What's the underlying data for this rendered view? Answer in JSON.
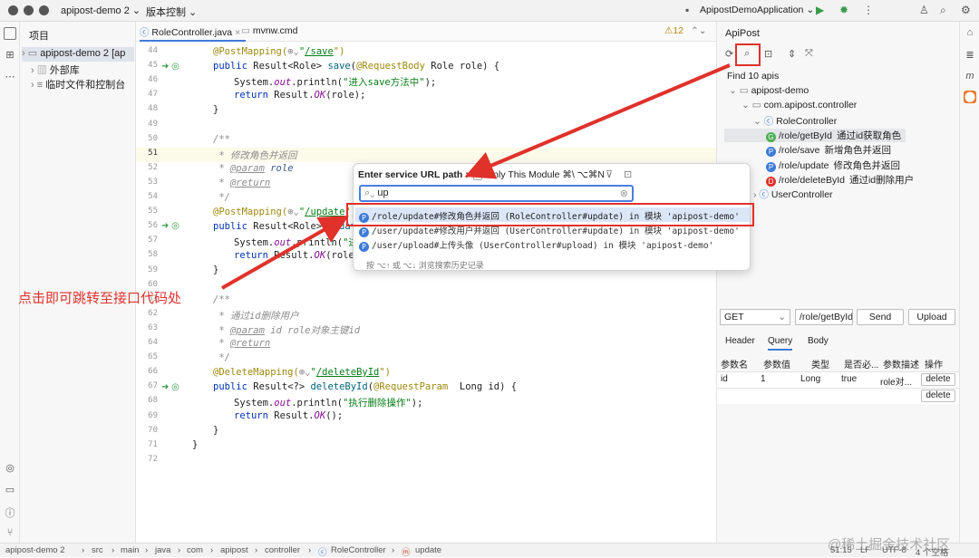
{
  "titlebar": {
    "project": "apipost-demo 2",
    "vcs": "版本控制",
    "run_config": "ApipostDemoApplication"
  },
  "project_panel": {
    "title": "项目",
    "root": "apipost-demo 2 [ap",
    "ext_libs": "外部库",
    "scratches": "临时文件和控制台"
  },
  "tabs": [
    {
      "label": "RoleController.java"
    },
    {
      "label": "mvnw.cmd"
    }
  ],
  "inspection": "⚠12",
  "line_numbers": [
    "44",
    "45",
    "46",
    "47",
    "48",
    "49",
    "50",
    "51",
    "52",
    "53",
    "54",
    "55",
    "56",
    "57",
    "58",
    "59",
    "60",
    "61",
    "62",
    "63",
    "64",
    "65",
    "66",
    "67",
    "68",
    "69",
    "70",
    "71",
    "72"
  ],
  "code": {
    "l44_ann": "@PostMapping(",
    "l44_icons": "⊕⌄",
    "l44_q": "\"",
    "l44_path": "/save",
    "l44_end": "\")",
    "l45_kw": "public ",
    "l45_a": "Result<Role> ",
    "l45_fn": "save",
    "l45_b": "(",
    "l45_ann": "@RequestBody ",
    "l45_c": "Role role) {",
    "l46_a": "System.",
    "l46_fld": "out",
    "l46_b": ".println(",
    "l46_str": "\"进入save方法中\"",
    "l46_c": ");",
    "l47_kw": "return ",
    "l47_a": "Result.",
    "l47_fn": "OK",
    "l47_b": "(role);",
    "l48": "}",
    "l50": "/**",
    "l51": " * 修改角色并返回",
    "l52_a": " * ",
    "l52_tag": "@param",
    "l52_b": " role",
    "l53_a": " * ",
    "l53_tag": "@return",
    "l54": " */",
    "l55_ann": "@PostMapping(",
    "l55_icons": "⊕⌄",
    "l55_q": "\"",
    "l55_path": "/update",
    "l55_end": "\")",
    "l56_kw": "public ",
    "l56_a": "Result<Role> ",
    "l56_fn": "update",
    "l57_a": "System.",
    "l57_fld": "out",
    "l57_b": ".println(",
    "l57_str": "\"进入",
    "l58_kw": "return ",
    "l58_a": "Result.",
    "l58_fn": "OK",
    "l58_b": "(role)",
    "l59": "}",
    "l61": "/**",
    "l62": " * 通过id删除用户",
    "l63_a": " * ",
    "l63_tag": "@param",
    "l63_b": " id role对象主键id",
    "l64_a": " * ",
    "l64_tag": "@return",
    "l65": " */",
    "l66_ann": "@DeleteMapping(",
    "l66_icons": "⊕⌄",
    "l66_q": "\"",
    "l66_path": "/deleteById",
    "l66_end": "\")",
    "l67_kw": "public ",
    "l67_a": "Result<?> ",
    "l67_fn": "deleteById",
    "l67_b": "(",
    "l67_ann": "@RequestParam ",
    "l67_c": " Long id) {",
    "l68_a": "System.",
    "l68_fld": "out",
    "l68_b": ".println(",
    "l68_str": "\"执行删除操作\"",
    "l68_c": ");",
    "l69_kw": "return ",
    "l69_a": "Result.",
    "l69_fn": "OK",
    "l69_b": "();",
    "l70": "}",
    "l71": "}"
  },
  "popup": {
    "title": "Enter service URL path :",
    "only_module": "Only This Module ⌘\\ ⌥⌘N",
    "query": "up",
    "results": [
      {
        "badge": "P",
        "text": "/role/update#修改角色并返回 (RoleController#update) in 模块 'apipost-demo'"
      },
      {
        "badge": "P",
        "text": "/user/update#修改用户并返回 (UserController#update) in 模块 'apipost-demo'"
      },
      {
        "badge": "P",
        "text": "/user/upload#上传头像 (UserController#upload) in 模块 'apipost-demo'"
      }
    ],
    "hint": "按 ⌥↑ 或 ⌥↓ 浏览搜索历史记录"
  },
  "annotation": "点击即可跳转至接口代码处",
  "apipost": {
    "title": "ApiPost",
    "find": "Find 10 apis",
    "tree": {
      "project": "apipost-demo",
      "package": "com.apipost.controller",
      "role_controller": "RoleController",
      "user_controller": "UserController"
    },
    "apis": [
      {
        "badge": "G",
        "color": "#4caf50",
        "path": "/role/getById",
        "desc": "通过id获取角色"
      },
      {
        "badge": "P",
        "color": "#3d7bd8",
        "path": "/role/save",
        "desc": "新增角色并返回"
      },
      {
        "badge": "P",
        "color": "#3d7bd8",
        "path": "/role/update",
        "desc": "修改角色并返回"
      },
      {
        "badge": "D",
        "color": "#e0312b",
        "path": "/role/deleteById",
        "desc": "通过id删除用户"
      }
    ],
    "method": "GET",
    "url": "/role/getById",
    "send": "Send",
    "upload": "Upload",
    "param_tabs": [
      "Header",
      "Query",
      "Body"
    ],
    "headers": [
      "参数名",
      "参数值",
      "类型",
      "是否必...",
      "参数描述",
      "操作"
    ],
    "row": {
      "name": "id",
      "value": "1",
      "type": "Long",
      "required": "true",
      "desc": "role对...",
      "action": "delete"
    },
    "row2_action": "delete"
  },
  "status": {
    "project": "apipost-demo 2",
    "src": "src",
    "main": "main",
    "java": "java",
    "com": "com",
    "apipost": "apipost",
    "controller": "controller",
    "class": "RoleController",
    "method": "update",
    "pos": "51:15",
    "lf": "LF",
    "enc": "UTF-8",
    "indent": "4 个空格"
  },
  "watermark": "@稀土掘金技术社区"
}
